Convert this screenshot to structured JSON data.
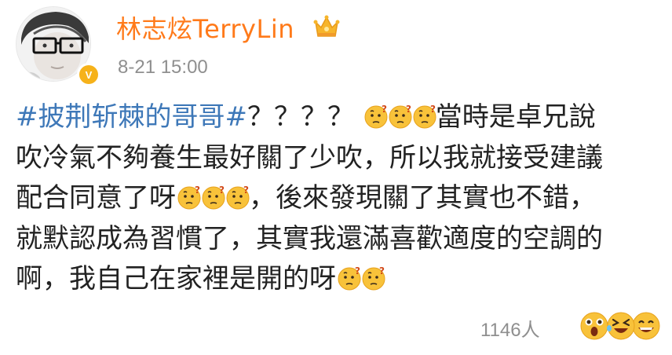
{
  "post": {
    "author": "林志炫TerryLin",
    "timestamp": "8-21 15:00",
    "hashtag": "#披荆斩棘的哥哥#",
    "line1_after_hashtag": "？？？？",
    "line1_after_emojis": "當時是卓兄說",
    "line2": "吹冷氣不夠養生最好關了少吹，所以我就接受建議",
    "line3_before_emojis": "配合同意了呀",
    "line3_after_emojis": "，後來發現關了其實也不錯，",
    "line4": "就默認成為習慣了，其實我還滿喜歡適度的空調的",
    "line5_before_emojis": "啊，我自己在家裡是開的呀",
    "inline_emoji": "thinking-face-icon"
  },
  "footer": {
    "likes_count": "1146人",
    "reactions": [
      "surprised-face-icon",
      "laughing-face-icon",
      "grinning-face-icon"
    ]
  },
  "colors": {
    "author": "#ff7a1a",
    "hashtag": "#3e78b8",
    "meta": "#8f8f8f",
    "text": "#222222",
    "emoji": "#f8c23a"
  }
}
